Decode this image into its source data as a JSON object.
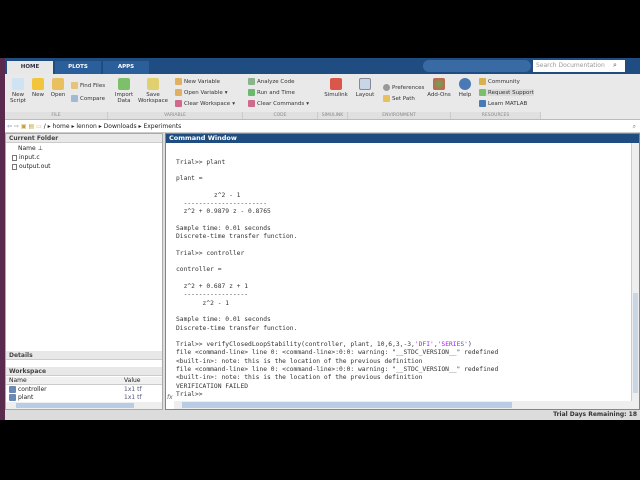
{
  "tabs": [
    "HOME",
    "PLOTS",
    "APPS"
  ],
  "search_placeholder": "Search Documentation",
  "ribbon": {
    "new_script": "New Script",
    "new": "New",
    "open": "Open",
    "find_files": "Find Files",
    "compare": "Compare",
    "import_data": "Import Data",
    "save_workspace": "Save Workspace",
    "new_variable": "New Variable",
    "open_variable": "Open Variable",
    "clear_workspace": "Clear Workspace",
    "analyze_code": "Analyze Code",
    "run_and_time": "Run and Time",
    "clear_commands": "Clear Commands",
    "simulink": "Simulink",
    "layout": "Layout",
    "preferences": "Preferences",
    "set_path": "Set Path",
    "add_ons": "Add-Ons",
    "help": "Help",
    "community": "Community",
    "request_support": "Request Support",
    "learn_matlab": "Learn MATLAB",
    "sections": [
      "FILE",
      "VARIABLE",
      "CODE",
      "SIMULINK",
      "ENVIRONMENT",
      "RESOURCES"
    ]
  },
  "address": {
    "path": [
      "/",
      "home",
      "lennon",
      "Downloads",
      "Experiments"
    ]
  },
  "current_folder": {
    "title": "Current Folder",
    "column": "Name",
    "files": [
      "input.c",
      "output.out"
    ]
  },
  "details": {
    "title": "Details"
  },
  "workspace": {
    "title": "Workspace",
    "columns": [
      "Name",
      "Value"
    ],
    "rows": [
      {
        "name": "controller",
        "value": "1x1 tf"
      },
      {
        "name": "plant",
        "value": "1x1 tf"
      }
    ]
  },
  "command_window": {
    "title": "Command Window",
    "lines": [
      "",
      "",
      "Trial>> plant",
      "",
      "plant =",
      "",
      "          z^2 - 1",
      "  ----------------------",
      "  z^2 + 0.9879 z - 0.8765",
      "",
      "Sample time: 0.01 seconds",
      "Discrete-time transfer function.",
      "",
      "Trial>> controller",
      "",
      "controller =",
      "",
      "  z^2 + 0.687 z + 1",
      "  -----------------",
      "       z^2 - 1",
      "",
      "Sample time: 0.01 seconds",
      "Discrete-time transfer function.",
      ""
    ],
    "verify_cmd": "Trial>> verifyClosedLoopStability(controller, plant, 10,6,3,-3,",
    "verify_arg1": "'DFI'",
    "verify_sep": ",",
    "verify_arg2": "'SERIES'",
    "verify_end": ")",
    "output": [
      "file <command-line> line 0: <command-line>:0:0: warning: \"__STDC_VERSION__\" redefined",
      "<built-in>: note: this is the location of the previous definition",
      "file <command-line> line 0: <command-line>:0:0: warning: \"__STDC_VERSION__\" redefined",
      "<built-in>: note: this is the location of the previous definition",
      "VERIFICATION FAILED"
    ],
    "prompt": "Trial>>",
    "fx": "fx"
  },
  "status": "Trial Days Remaining: 18"
}
